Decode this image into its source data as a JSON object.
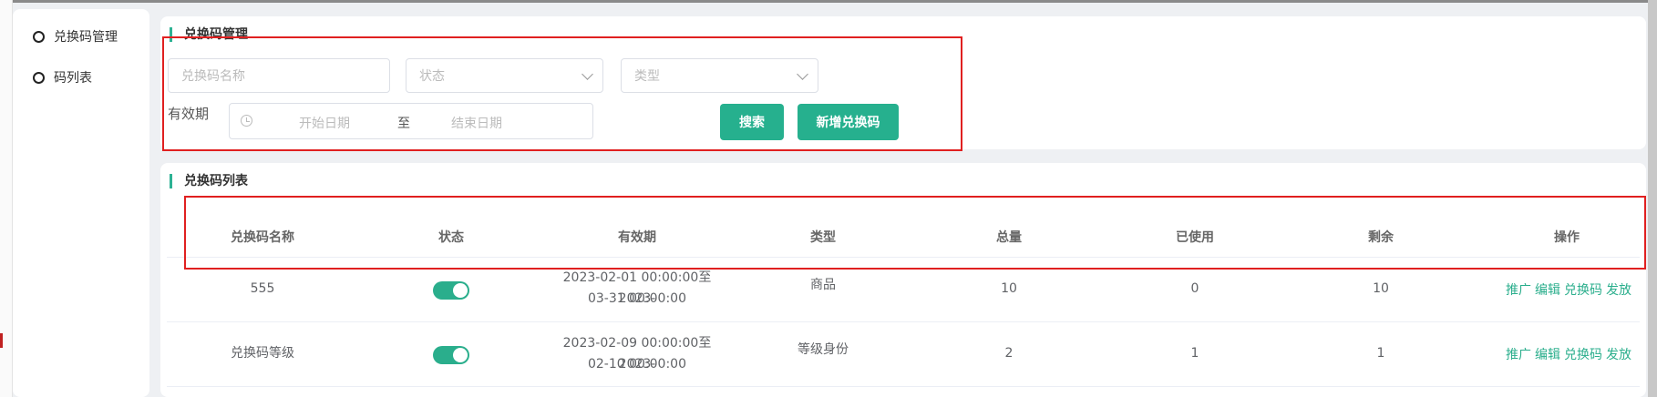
{
  "sidebar": {
    "items": [
      {
        "label": "兑换码管理"
      },
      {
        "label": "码列表"
      }
    ]
  },
  "search_panel": {
    "title": "兑换码管理",
    "name_placeholder": "兑换码名称",
    "status_placeholder": "状态",
    "type_placeholder": "类型",
    "validity_label": "有效期",
    "start_placeholder": "开始日期",
    "separator": "至",
    "end_placeholder": "结束日期",
    "search_button": "搜索",
    "add_button": "新增兑换码"
  },
  "list_panel": {
    "title": "兑换码列表",
    "columns": [
      "兑换码名称",
      "状态",
      "有效期",
      "类型",
      "总量",
      "已使用",
      "剩余",
      "操作"
    ],
    "rows": [
      {
        "name": "555",
        "status_on": true,
        "validity_line1": "2023-02-01 00:00:00至2023-",
        "validity_line2": "03-31 00:00:00",
        "type": "商品",
        "total": "10",
        "used": "0",
        "remaining": "10"
      },
      {
        "name": "兑换码等级",
        "status_on": true,
        "validity_line1": "2023-02-09 00:00:00至2023-",
        "validity_line2": "02-10 00:00:00",
        "type": "等级身份",
        "total": "2",
        "used": "1",
        "remaining": "1"
      }
    ],
    "actions": [
      "推广",
      "编辑",
      "兑换码",
      "发放"
    ]
  },
  "colors": {
    "accent": "#26b08e",
    "highlight_box": "#e02020"
  }
}
